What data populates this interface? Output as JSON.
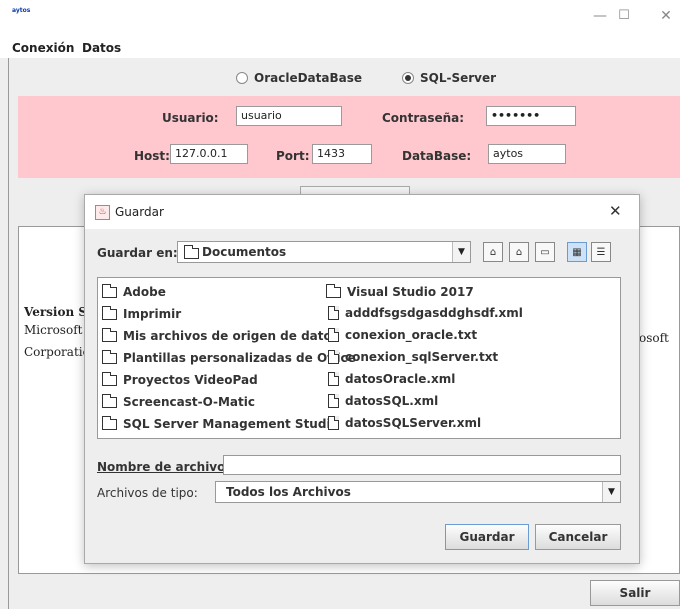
{
  "window": {
    "app_label": "aytos",
    "minimize": "—",
    "maximize": "☐",
    "close": "✕"
  },
  "menu": {
    "items": [
      "Conexión",
      "Datos"
    ]
  },
  "db_options": {
    "oracle_label": "OracleDataBase",
    "sqlserver_label": "SQL-Server",
    "selected": "SQL-Server"
  },
  "connection": {
    "user_label": "Usuario:",
    "user_value": "usuario",
    "password_label": "Contraseña:",
    "password_value": "•••••••",
    "host_label": "Host:",
    "host_value": "127.0.0.1",
    "port_label": "Port:",
    "port_value": "1433",
    "db_label": "DataBase:",
    "db_value": "aytos"
  },
  "info": {
    "line1": "Version S",
    "line2": "Microsoft",
    "line2_right": "osoft",
    "line3": "Corporatio"
  },
  "exit_label": "Salir",
  "dialog": {
    "title": "Guardar",
    "close": "✕",
    "save_in_label": "Guardar en:",
    "save_in_value": "Documentos",
    "folders_left": [
      "Adobe",
      "Imprimir",
      "Mis archivos de origen de datos",
      "Plantillas personalizadas de Office",
      "Proyectos VideoPad",
      "Screencast-O-Matic",
      "SQL Server Management Studio"
    ],
    "items_right": [
      {
        "name": "Visual Studio 2017",
        "kind": "folder"
      },
      {
        "name": "adddfsgsdgasddghsdf.xml",
        "kind": "file"
      },
      {
        "name": "conexion_oracle.txt",
        "kind": "file"
      },
      {
        "name": "conexion_sqlServer.txt",
        "kind": "file"
      },
      {
        "name": "datosOracle.xml",
        "kind": "file"
      },
      {
        "name": "datosSQL.xml",
        "kind": "file"
      },
      {
        "name": "datosSQLServer.xml",
        "kind": "file"
      }
    ],
    "filename_label": "Nombre de archivo:",
    "filename_value": "",
    "filetype_label": "Archivos de tipo:",
    "filetype_value": "Todos los Archivos",
    "save_button": "Guardar",
    "cancel_button": "Cancelar"
  }
}
